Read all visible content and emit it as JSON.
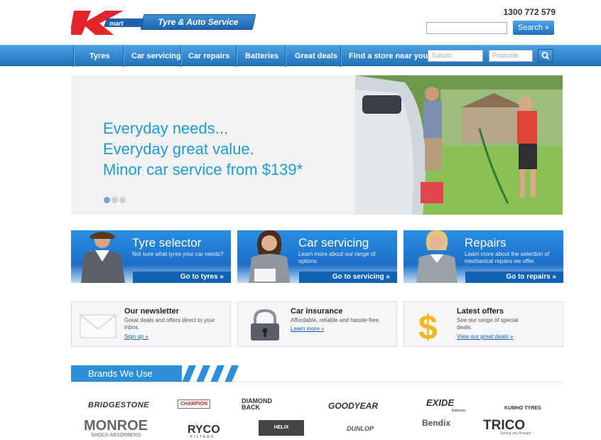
{
  "header": {
    "logo_text": "Tyre & Auto Service",
    "phone": "1300 772 579",
    "search_button": "Search »"
  },
  "nav": {
    "items": [
      "Tyres",
      "Car servicing",
      "Car repairs",
      "Batteries",
      "Great deals",
      "Find a store near you"
    ],
    "suburb_placeholder": "Suburb",
    "postcode_placeholder": "Postcode"
  },
  "hero": {
    "line1": "Everyday needs...",
    "line2": "Everyday great value.",
    "line3": "Minor car service from $139*"
  },
  "cards": [
    {
      "title": "Tyre selector",
      "desc": "Not sure what tyres your car needs?",
      "link": "Go to tyres »"
    },
    {
      "title": "Car servicing",
      "desc": "Learn more about our range of options.",
      "link": "Go to servicing »"
    },
    {
      "title": "Repairs",
      "desc": "Learn more about the selection of mechanical repairs we offer.",
      "link": "Go to repairs »"
    }
  ],
  "info": [
    {
      "title": "Our newsletter",
      "desc": "Great deals and offers direct to your inbox.",
      "link": "Sign up »",
      "icon": "envelope-icon"
    },
    {
      "title": "Car insurance",
      "desc": "Affordable, reliable and hassle-free.",
      "link": "Learn more »",
      "icon": "padlock-icon"
    },
    {
      "title": "Latest offers",
      "desc": "See our range of special deals.",
      "link": "View our great deals »",
      "icon": "dollar-icon"
    }
  ],
  "brands": {
    "heading": "Brands We Use",
    "row1": [
      "BRIDGESTONE",
      "CHAMPION",
      "DIAMOND BACK",
      "GOODYEAR",
      "EXIDE",
      "Batteries",
      "KUMHO TYRES"
    ],
    "row2": [
      "MONROE",
      "SHOCK ABSORBERS",
      "RYCO",
      "FILTERS",
      "HELIX",
      "DUNLOP",
      "Bendix",
      "TRICO",
      "Seeing you through"
    ]
  }
}
